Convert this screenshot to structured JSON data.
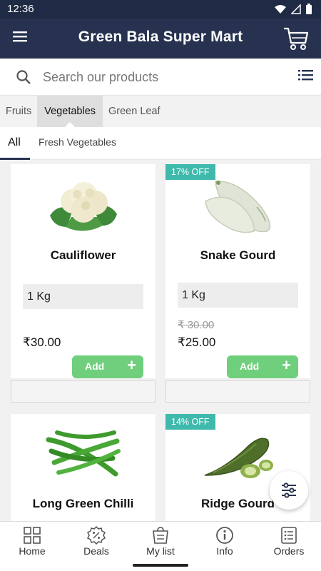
{
  "status_bar": {
    "time": "12:36"
  },
  "app_bar": {
    "title": "Green Bala Super Mart"
  },
  "search": {
    "placeholder": "Search our products"
  },
  "category_tabs": [
    {
      "label": "Fruits"
    },
    {
      "label": "Vegetables"
    },
    {
      "label": "Green Leaf"
    }
  ],
  "selected_category": "Vegetables",
  "sub_tabs": [
    {
      "label": "All"
    },
    {
      "label": "Fresh Vegetables"
    }
  ],
  "products": [
    {
      "name": "Cauliflower",
      "quantity": "1 Kg",
      "price": "₹30.00",
      "old_price": "",
      "discount": "",
      "add_label": "Add",
      "icon": "cauliflower-image"
    },
    {
      "name": "Snake Gourd",
      "quantity": "1 Kg",
      "price": "₹25.00",
      "old_price": "₹ 30.00",
      "discount": "17% OFF",
      "add_label": "Add",
      "icon": "snake-gourd-image"
    },
    {
      "name": "Long Green Chilli",
      "discount": "",
      "icon": "green-chilli-image"
    },
    {
      "name": "Ridge Gourd",
      "discount": "14% OFF",
      "icon": "ridge-gourd-image"
    }
  ],
  "bottom_nav": [
    {
      "label": "Home",
      "icon": "grid-icon"
    },
    {
      "label": "Deals",
      "icon": "discount-icon"
    },
    {
      "label": "My list",
      "icon": "list-bag-icon"
    },
    {
      "label": "Info",
      "icon": "info-icon"
    },
    {
      "label": "Orders",
      "icon": "orders-icon"
    }
  ],
  "colors": {
    "app_bar": "#26324f",
    "add_button": "#6fcf7d",
    "discount_badge": "#3fb9ac"
  }
}
